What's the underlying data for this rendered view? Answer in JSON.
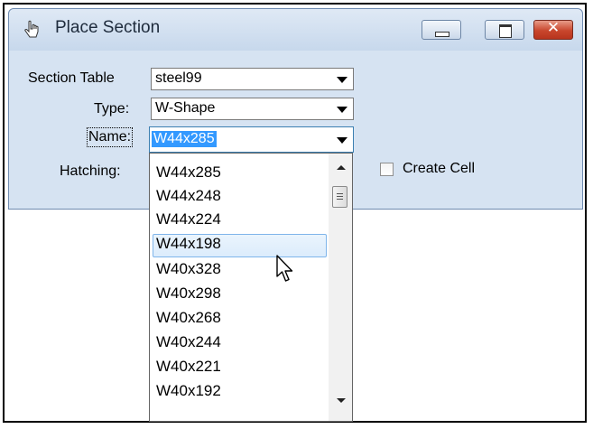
{
  "window": {
    "title": "Place Section",
    "icon": "hand-pointer-icon",
    "close_glyph": "✕"
  },
  "form": {
    "section_table_label": "Section Table",
    "section_table_value": "steel99",
    "type_label": "Type:",
    "type_value": "W-Shape",
    "name_label": "Name:",
    "name_value": "W44x285",
    "hatching_label": "Hatching:",
    "create_cell_label": "Create Cell",
    "create_cell_checked": false
  },
  "dropdown": {
    "items": [
      "W44x285",
      "W44x248",
      "W44x224",
      "W44x198",
      "W40x328",
      "W40x298",
      "W40x268",
      "W40x244",
      "W40x221",
      "W40x192"
    ],
    "hovered_item": "W44x198"
  },
  "colors": {
    "selection": "#3399ff",
    "dialog_bg": "#d6e3f2",
    "close_button": "#c9462d"
  }
}
